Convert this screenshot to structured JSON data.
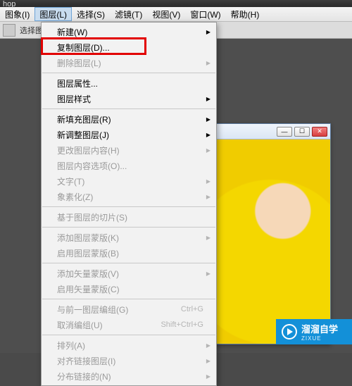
{
  "app_fragment": "hop",
  "menubar": {
    "items": [
      {
        "label": "图象(I)"
      },
      {
        "label": "图层(L)"
      },
      {
        "label": "选择(S)"
      },
      {
        "label": "滤镜(T)"
      },
      {
        "label": "视图(V)"
      },
      {
        "label": "窗口(W)"
      },
      {
        "label": "帮助(H)"
      }
    ],
    "active_index": 1
  },
  "toolbar": {
    "hint": "选择图层"
  },
  "dropdown": {
    "items": [
      {
        "label": "新建(W)",
        "arrow": true
      },
      {
        "label": "复制图层(D)...",
        "highlight": true
      },
      {
        "label": "删除图层(L)",
        "disabled": true,
        "arrow": true
      },
      {
        "sep": true
      },
      {
        "label": "图层属性..."
      },
      {
        "label": "图层样式",
        "arrow": true
      },
      {
        "sep": true
      },
      {
        "label": "新填充图层(R)",
        "arrow": true
      },
      {
        "label": "新调整图层(J)",
        "arrow": true
      },
      {
        "label": "更改图层内容(H)",
        "disabled": true,
        "arrow": true
      },
      {
        "label": "图层内容选项(O)...",
        "disabled": true
      },
      {
        "label": "文字(T)",
        "disabled": true,
        "arrow": true
      },
      {
        "label": "象素化(Z)",
        "disabled": true,
        "arrow": true
      },
      {
        "sep": true
      },
      {
        "label": "基于图层的切片(S)",
        "disabled": true
      },
      {
        "sep": true
      },
      {
        "label": "添加图层蒙版(K)",
        "disabled": true,
        "arrow": true
      },
      {
        "label": "启用图层蒙版(B)",
        "disabled": true
      },
      {
        "sep": true
      },
      {
        "label": "添加矢量蒙版(V)",
        "disabled": true,
        "arrow": true
      },
      {
        "label": "启用矢量蒙版(C)",
        "disabled": true
      },
      {
        "sep": true
      },
      {
        "label": "与前一图层编组(G)",
        "disabled": true,
        "shortcut": "Ctrl+G"
      },
      {
        "label": "取消编组(U)",
        "disabled": true,
        "shortcut": "Shift+Ctrl+G"
      },
      {
        "sep": true
      },
      {
        "label": "排列(A)",
        "disabled": true,
        "arrow": true
      },
      {
        "label": "对齐链接图层(I)",
        "disabled": true,
        "arrow": true
      },
      {
        "label": "分布链接的(N)",
        "disabled": true,
        "arrow": true
      }
    ]
  },
  "window_controls": {
    "min": "—",
    "max": "☐",
    "close": "✕"
  },
  "watermark": {
    "brand": "溜溜自学",
    "sub": "ZIXUE"
  }
}
